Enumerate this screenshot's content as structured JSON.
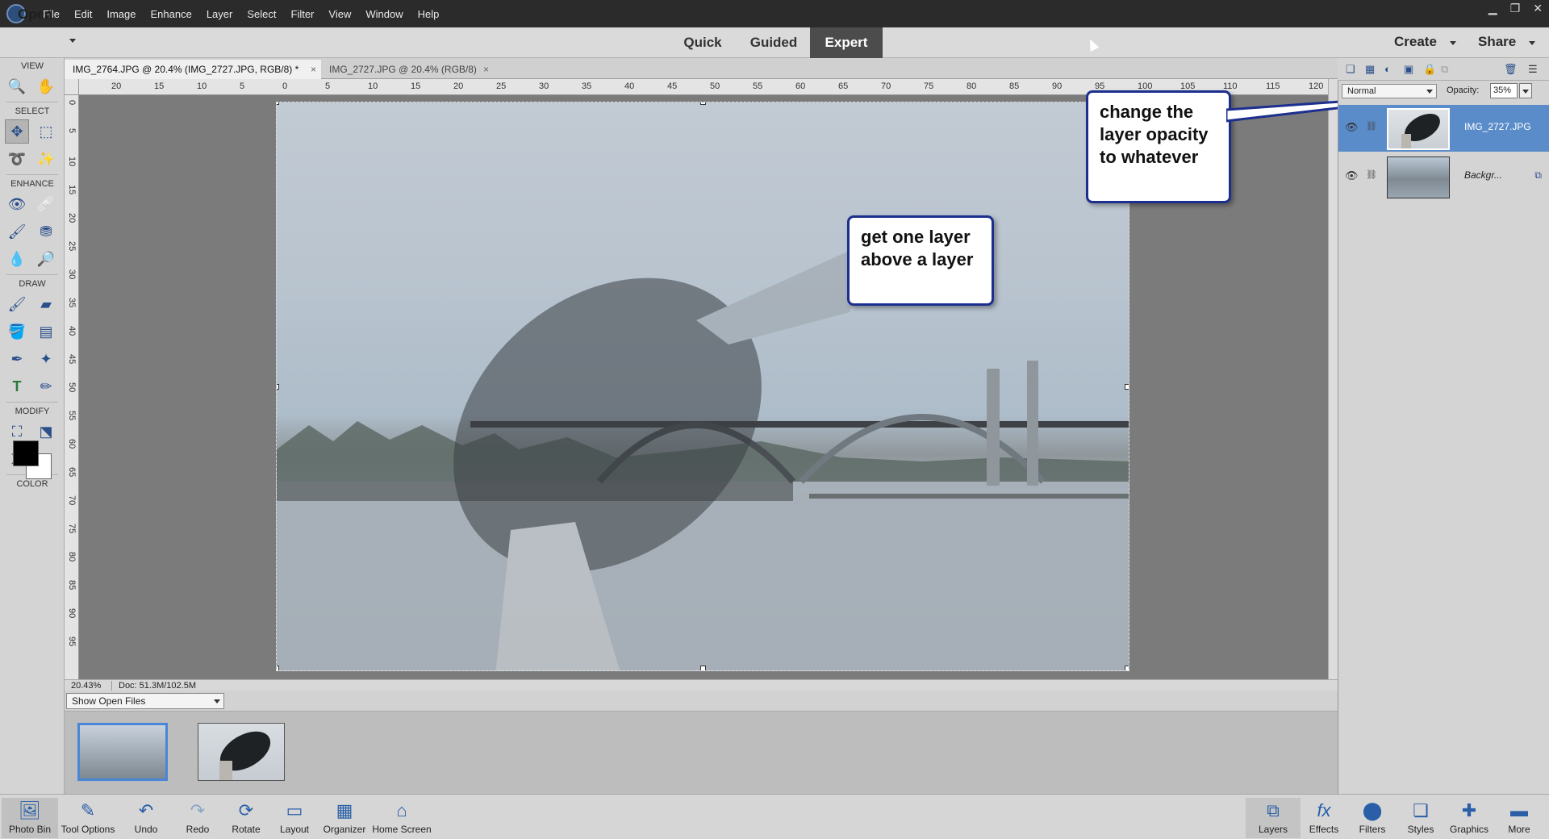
{
  "menubar": {
    "items": [
      "File",
      "Edit",
      "Image",
      "Enhance",
      "Layer",
      "Select",
      "Filter",
      "View",
      "Window",
      "Help"
    ],
    "win_min": "▁",
    "win_restore": "❐",
    "win_close": "✕"
  },
  "modebar": {
    "open_label": "Open",
    "tabs": [
      "Quick",
      "Guided",
      "Expert"
    ],
    "active_tab": "Expert",
    "create_label": "Create",
    "share_label": "Share"
  },
  "toolbox": {
    "sections": {
      "view": "VIEW",
      "select": "SELECT",
      "enhance": "ENHANCE",
      "draw": "DRAW",
      "modify": "MODIFY",
      "color": "COLOR"
    },
    "colors": {
      "foreground": "#000000",
      "background": "#ffffff"
    }
  },
  "document_tabs": [
    {
      "label": "IMG_2764.JPG @ 20.4% (IMG_2727.JPG, RGB/8) *",
      "close": "×"
    },
    {
      "label": "IMG_2727.JPG @ 20.4% (RGB/8)",
      "close": "×"
    }
  ],
  "ruler": {
    "h_ticks": [
      "20",
      "15",
      "10",
      "5",
      "0",
      "5",
      "10",
      "15",
      "20",
      "25",
      "30",
      "35",
      "40",
      "45",
      "50",
      "55",
      "60",
      "65",
      "70",
      "75",
      "80",
      "85",
      "90",
      "95",
      "100",
      "105",
      "110",
      "115",
      "120"
    ],
    "v_ticks": [
      "0",
      "5",
      "10",
      "15",
      "20",
      "25",
      "30",
      "35",
      "40",
      "45",
      "50",
      "55",
      "60",
      "65",
      "70",
      "75",
      "80",
      "85",
      "90",
      "95"
    ]
  },
  "status": {
    "zoom": "20.43%",
    "doc": "Doc: 51.3M/102.5M"
  },
  "photo_bin": {
    "show_label": "Show Open Files"
  },
  "layers": {
    "blend_mode": "Normal",
    "opacity_label": "Opacity:",
    "opacity_value": "35%",
    "items": [
      {
        "name": "IMG_2727.JPG",
        "selected": true
      },
      {
        "name": "Backgr...",
        "selected": false
      }
    ]
  },
  "bottombar": {
    "left": [
      "Photo Bin",
      "Tool Options",
      "Undo",
      "Redo",
      "Rotate",
      "Layout",
      "Organizer",
      "Home Screen"
    ],
    "right": [
      "Layers",
      "Effects",
      "Filters",
      "Styles",
      "Graphics",
      "More"
    ]
  },
  "callouts": {
    "layer_above": "get one layer above a layer",
    "opacity": "change the layer opacity to whatever"
  },
  "accent_colors": {
    "selection_blue": "#5a8cc9",
    "callout_border": "#1c2f8f",
    "icon_blue": "#2a5fa8"
  }
}
